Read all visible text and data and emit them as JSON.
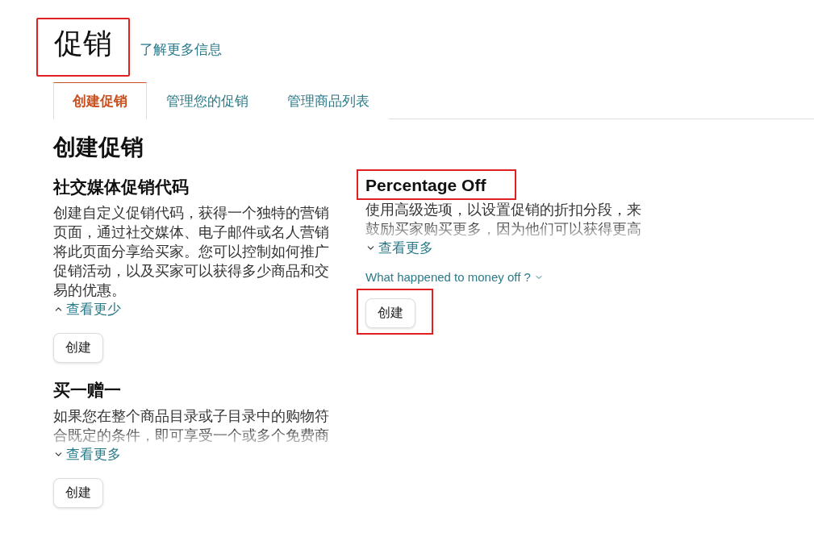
{
  "page": {
    "title": "促销",
    "title_highlighted": true,
    "help_link": "了解更多信息"
  },
  "tabs": [
    {
      "label": "创建促销",
      "selected": true
    },
    {
      "label": "管理您的促销",
      "selected": false
    },
    {
      "label": "管理商品列表",
      "selected": false
    }
  ],
  "section_title": "创建促销",
  "columns": [
    [
      {
        "title": "社交媒体促销代码",
        "title_highlighted": false,
        "description": "创建自定义促销代码，获得一个独特的营销页面，通过社交媒体、电子邮件或名人营销将此页面分享给买家。您可以控制如何推广促销活动，以及买家可以获得多少商品和交易的优惠。",
        "expanded": true,
        "toggle": "查看更少",
        "button": "创建",
        "button_highlighted": false
      },
      {
        "title": "买一赠一",
        "title_highlighted": false,
        "description": "如果您在整个商品目录或子目录中的购物符合既定的条件，即可享受一个或多个免费商",
        "expanded": false,
        "toggle": "查看更多",
        "button": "创建",
        "button_highlighted": false
      }
    ],
    [
      {
        "title": "Percentage Off",
        "title_highlighted": true,
        "description": "使用高级选项，以设置促销的折扣分段，来鼓励买家购买更多，因为他们可以获得更高",
        "expanded": false,
        "toggle": "查看更多",
        "extra_link": "What happened to money off ?",
        "button": "创建",
        "button_highlighted": true
      }
    ]
  ]
}
